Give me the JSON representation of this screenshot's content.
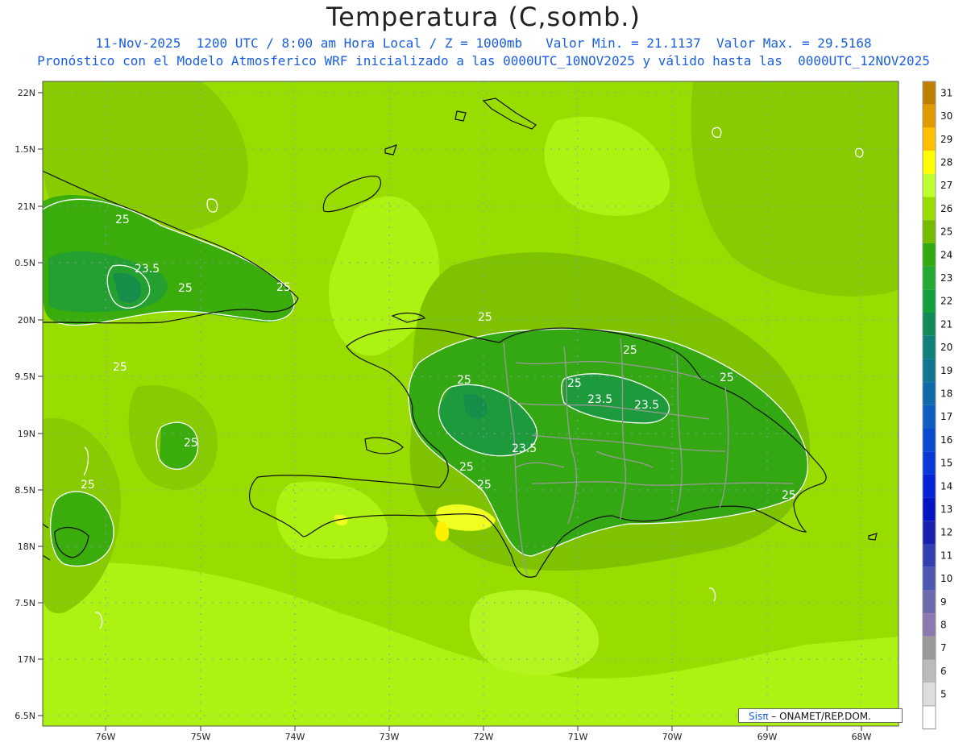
{
  "header": {
    "title": "Temperatura (C,somb.)",
    "subtitle1": "11-Nov-2025  1200 UTC / 8:00 am Hora Local / Z = 1000mb   Valor Min. = 21.1137  Valor Max. = 29.5168",
    "subtitle2": "Pronóstico con el Modelo Atmosferico WRF inicializado a las 0000UTC_10NOV2025 y válido hasta las  0000UTC_12NOV2025"
  },
  "map": {
    "lat_ticks": [
      "22N",
      "1.5N",
      "21N",
      "0.5N",
      "20N",
      "9.5N",
      "19N",
      "8.5N",
      "18N",
      "7.5N",
      "17N",
      "6.5N"
    ],
    "lon_ticks": [
      "76W",
      "75W",
      "74W",
      "73W",
      "72W",
      "71W",
      "70W",
      "69W",
      "68W"
    ],
    "contour_labels": [
      "25",
      "23.5",
      "25",
      "25",
      "25",
      "25",
      "25",
      "25",
      "23.5",
      "23.5",
      "23.5",
      "25",
      "25",
      "25",
      "25",
      "25",
      "25",
      "25"
    ]
  },
  "colorbar": {
    "levels": [
      "31",
      "30",
      "29",
      "28",
      "27",
      "26",
      "25",
      "24",
      "23",
      "22",
      "21",
      "20",
      "19",
      "18",
      "17",
      "16",
      "15",
      "14",
      "13",
      "12",
      "11",
      "10",
      "9",
      "8",
      "7",
      "6",
      "5"
    ],
    "colors": [
      "#c07e00",
      "#e09b00",
      "#ffc000",
      "#ffff00",
      "#c0ff30",
      "#99dd00",
      "#77bb00",
      "#33aa10",
      "#22aa33",
      "#15a040",
      "#128a5a",
      "#10807a",
      "#0f7890",
      "#0e6aa8",
      "#0d5ec0",
      "#0a4acf",
      "#0838d8",
      "#0524d8",
      "#0414c0",
      "#1a20b0",
      "#3040b0",
      "#4e58b0",
      "#6e6ab0",
      "#8a7ab0",
      "#9a9a9a",
      "#bbbbbb",
      "#dddddd"
    ],
    "bottom_color": "#ffffff"
  },
  "credit": {
    "logo": "Sisπ",
    "text": "– ONAMET/REP.DOM."
  }
}
